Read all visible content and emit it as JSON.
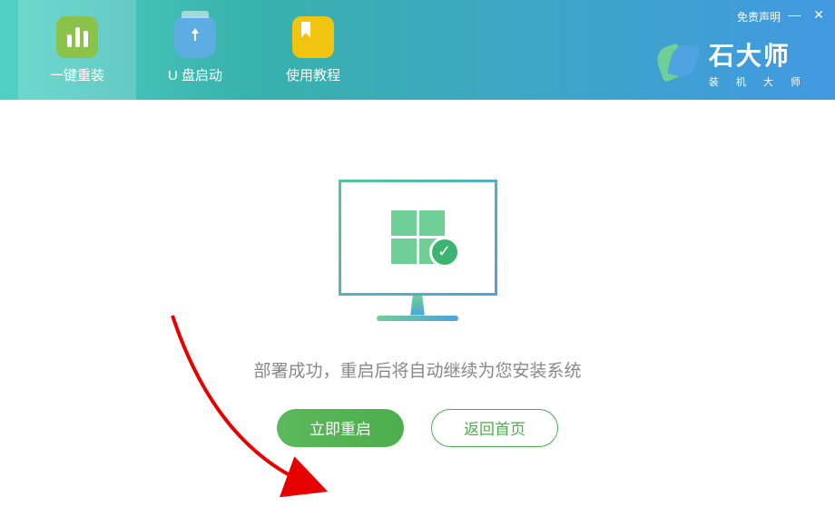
{
  "header": {
    "disclaimer": "免责声明",
    "tabs": [
      {
        "label": "一键重装",
        "icon": "reinstall-icon"
      },
      {
        "label": "U 盘启动",
        "icon": "usb-icon"
      },
      {
        "label": "使用教程",
        "icon": "tutorial-icon"
      }
    ]
  },
  "brand": {
    "title": "石大师",
    "subtitle": "装 机 大 师"
  },
  "main": {
    "status": "部署成功，重启后将自动继续为您安装系统",
    "primaryBtn": "立即重启",
    "secondaryBtn": "返回首页"
  }
}
